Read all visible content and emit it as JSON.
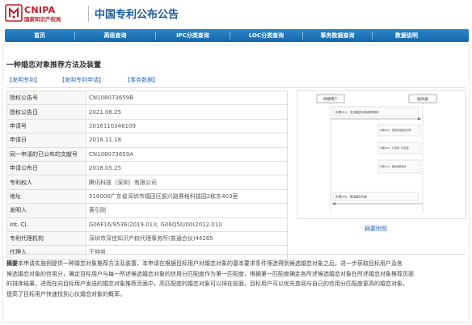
{
  "header": {
    "logo_en": "CNIPA",
    "logo_cn": "国家知识产权局",
    "site_title": "中国专利公布公告",
    "brand_color": "#c21d24",
    "nav_color": "#1f74b8"
  },
  "nav": {
    "items": [
      {
        "label": "首页"
      },
      {
        "label": "高级查询"
      },
      {
        "label": "IPC分类查询"
      },
      {
        "label": "LOC分类查询"
      },
      {
        "label": "事务数据查询"
      },
      {
        "label": "数据说明"
      }
    ]
  },
  "patent": {
    "title": "一种婚恋对象推荐方法及装置",
    "tabs": [
      {
        "label": "【发明专利】"
      },
      {
        "label": "【发明专利申请】"
      },
      {
        "label": "【事务数据】"
      }
    ],
    "fields": [
      {
        "key": "授权公告号",
        "value": "CN108073659B"
      },
      {
        "key": "授权公告日",
        "value": "2021.06.25"
      },
      {
        "key": "申请号",
        "value": "2016110346109"
      },
      {
        "key": "申请日",
        "value": "2016.11.18"
      },
      {
        "key": "同一申请的已公布的文献号",
        "value": "CN108073659A"
      },
      {
        "key": "申请公布日",
        "value": "2018.05.25"
      },
      {
        "key": "专利权人",
        "value": "腾讯科技（深圳）有限公司"
      },
      {
        "key": "地址",
        "value": "518000广东省深圳市福田区振兴路赛格科技园2栋东403室"
      },
      {
        "key": "发明人",
        "value": "黄引刚"
      },
      {
        "key": "Int. Cl.",
        "value": "G06F16/9536(2019.01)I; G06Q50/00(2012.01)I"
      },
      {
        "key": "专利代理机构",
        "value": "深圳市深佳知识产权代理事务所(普通合伙)44285"
      },
      {
        "key": "代理人",
        "value": "王仲凯"
      }
    ],
    "drawing_caption": "摘要附图",
    "drawing_steps": [
      {
        "label": "终端用户"
      },
      {
        "label": "服务器"
      },
      {
        "label": "步骤S10、发送婚恋对象推荐请求"
      },
      {
        "label": "步骤S20、获取候选婚恋对象"
      },
      {
        "label": "步骤S30、计算第一匹配度"
      },
      {
        "label": "步骤S40、确定推荐顺序"
      },
      {
        "label": "步骤S50、推送婚恋对象"
      }
    ],
    "abstract_label": "摘要",
    "abstract_lines": [
      "本申请实施例提供一种婚恋对象推荐方法及装置，本申请在根据目标用户对婚恋对象的基本要求条件筛选得到候选婚恋对象之后，进一步获取目标用户及各",
      "候选婚恋对象的信用分，确定目标用户与每一所述候选婚恋对象的信用分匹配度作为第一匹配度，根据第一匹配度确定各所述候选婚恋对象在所述婚恋对象推荐页面",
      "的排序结果，进而在向目标用户发送的婚恋对象推荐页面中，高匹配度的婚恋对象可以排在前面，目标用户可以优先查阅与自己的信用分匹配度更高的婚恋对象，",
      "提高了目标用户快速找到心仪婚恋对象的概率。"
    ]
  }
}
